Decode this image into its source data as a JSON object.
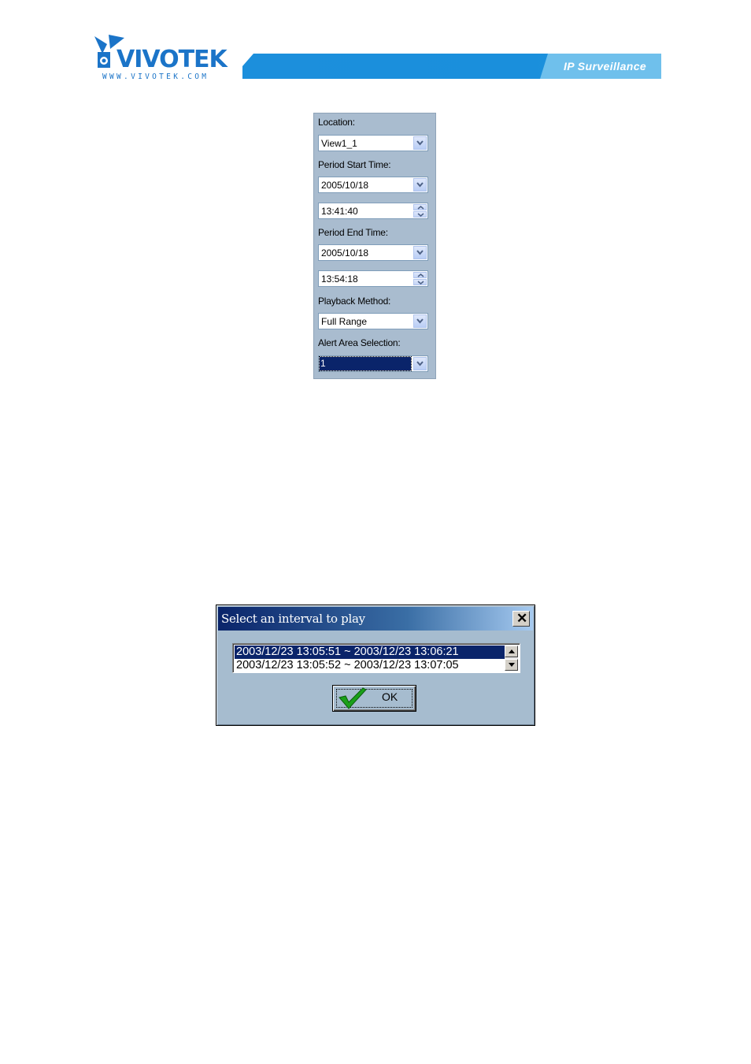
{
  "header": {
    "brand": "VIVOTEK",
    "url": "WWW.VIVOTEK.COM",
    "tagline": "IP Surveillance",
    "colors": {
      "brand_blue": "#1b74c8",
      "bar_blue": "#1a8fdc",
      "tab_blue": "#6fc0ec"
    }
  },
  "panel": {
    "location_label": "Location:",
    "location_value": "View1_1",
    "start_label": "Period Start Time:",
    "start_date": "2005/10/18",
    "start_time": "13:41:40",
    "end_label": "Period End Time:",
    "end_date": "2005/10/18",
    "end_time": "13:54:18",
    "method_label": "Playback Method:",
    "method_value": "Full Range",
    "alert_label": "Alert Area Selection:",
    "alert_value": "1"
  },
  "dialog": {
    "title": "Select an interval to play",
    "intervals": [
      "2003/12/23 13:05:51 ~ 2003/12/23 13:06:21",
      "2003/12/23 13:05:52 ~ 2003/12/23 13:07:05"
    ],
    "selected_index": 0,
    "ok_label": "OK",
    "icons": [
      "close-icon",
      "scroll-up-icon",
      "scroll-down-icon",
      "checkmark-icon"
    ]
  }
}
